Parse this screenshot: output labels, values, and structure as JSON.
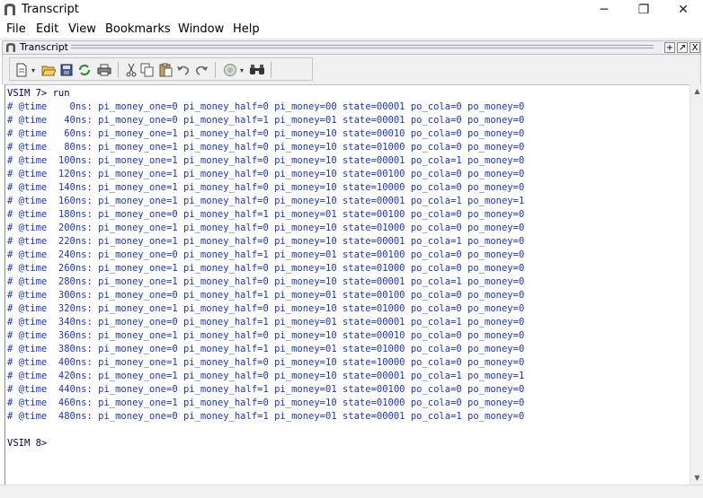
{
  "window": {
    "title": "Transcript",
    "minimize": "─",
    "maximize": "❐",
    "close": "✕"
  },
  "menu": [
    "File",
    "Edit",
    "View",
    "Bookmarks",
    "Window",
    "Help"
  ],
  "panel": {
    "title": "Transcript",
    "btn_dock": "+",
    "btn_undock": "↗",
    "btn_close": "X"
  },
  "toolbar": {
    "icons": [
      "new-document-icon",
      "open-folder-icon",
      "save-icon",
      "refresh-icon",
      "print-icon",
      "cut-icon",
      "copy-icon",
      "paste-icon",
      "undo-icon",
      "redo-icon",
      "run-icon",
      "find-icon"
    ]
  },
  "transcript": {
    "lines": [
      {
        "kind": "prompt",
        "text": "VSIM 7> run"
      },
      {
        "kind": "out",
        "text": "# @time    0ns: pi_money_one=0 pi_money_half=0 pi_money=00 state=00001 po_cola=0 po_money=0"
      },
      {
        "kind": "out",
        "text": "# @time   40ns: pi_money_one=0 pi_money_half=1 pi_money=01 state=00001 po_cola=0 po_money=0"
      },
      {
        "kind": "out",
        "text": "# @time   60ns: pi_money_one=1 pi_money_half=0 pi_money=10 state=00010 po_cola=0 po_money=0"
      },
      {
        "kind": "out",
        "text": "# @time   80ns: pi_money_one=1 pi_money_half=0 pi_money=10 state=01000 po_cola=0 po_money=0"
      },
      {
        "kind": "out",
        "text": "# @time  100ns: pi_money_one=1 pi_money_half=0 pi_money=10 state=00001 po_cola=1 po_money=0"
      },
      {
        "kind": "out",
        "text": "# @time  120ns: pi_money_one=1 pi_money_half=0 pi_money=10 state=00100 po_cola=0 po_money=0"
      },
      {
        "kind": "out",
        "text": "# @time  140ns: pi_money_one=1 pi_money_half=0 pi_money=10 state=10000 po_cola=0 po_money=0"
      },
      {
        "kind": "out",
        "text": "# @time  160ns: pi_money_one=1 pi_money_half=0 pi_money=10 state=00001 po_cola=1 po_money=1"
      },
      {
        "kind": "out",
        "text": "# @time  180ns: pi_money_one=0 pi_money_half=1 pi_money=01 state=00100 po_cola=0 po_money=0"
      },
      {
        "kind": "out",
        "text": "# @time  200ns: pi_money_one=1 pi_money_half=0 pi_money=10 state=01000 po_cola=0 po_money=0"
      },
      {
        "kind": "out",
        "text": "# @time  220ns: pi_money_one=1 pi_money_half=0 pi_money=10 state=00001 po_cola=1 po_money=0"
      },
      {
        "kind": "out",
        "text": "# @time  240ns: pi_money_one=0 pi_money_half=1 pi_money=01 state=00100 po_cola=0 po_money=0"
      },
      {
        "kind": "out",
        "text": "# @time  260ns: pi_money_one=1 pi_money_half=0 pi_money=10 state=01000 po_cola=0 po_money=0"
      },
      {
        "kind": "out",
        "text": "# @time  280ns: pi_money_one=1 pi_money_half=0 pi_money=10 state=00001 po_cola=1 po_money=0"
      },
      {
        "kind": "out",
        "text": "# @time  300ns: pi_money_one=0 pi_money_half=1 pi_money=01 state=00100 po_cola=0 po_money=0"
      },
      {
        "kind": "out",
        "text": "# @time  320ns: pi_money_one=1 pi_money_half=0 pi_money=10 state=01000 po_cola=0 po_money=0"
      },
      {
        "kind": "out",
        "text": "# @time  340ns: pi_money_one=0 pi_money_half=1 pi_money=01 state=00001 po_cola=1 po_money=0"
      },
      {
        "kind": "out",
        "text": "# @time  360ns: pi_money_one=1 pi_money_half=0 pi_money=10 state=00010 po_cola=0 po_money=0"
      },
      {
        "kind": "out",
        "text": "# @time  380ns: pi_money_one=0 pi_money_half=1 pi_money=01 state=01000 po_cola=0 po_money=0"
      },
      {
        "kind": "out",
        "text": "# @time  400ns: pi_money_one=1 pi_money_half=0 pi_money=10 state=10000 po_cola=0 po_money=0"
      },
      {
        "kind": "out",
        "text": "# @time  420ns: pi_money_one=1 pi_money_half=0 pi_money=10 state=00001 po_cola=1 po_money=1"
      },
      {
        "kind": "out",
        "text": "# @time  440ns: pi_money_one=0 pi_money_half=1 pi_money=01 state=00100 po_cola=0 po_money=0"
      },
      {
        "kind": "out",
        "text": "# @time  460ns: pi_money_one=1 pi_money_half=0 pi_money=10 state=01000 po_cola=0 po_money=0"
      },
      {
        "kind": "out",
        "text": "# @time  480ns: pi_money_one=0 pi_money_half=1 pi_money=01 state=00001 po_cola=1 po_money=0"
      },
      {
        "kind": "blank",
        "text": ""
      },
      {
        "kind": "prompt",
        "text": "VSIM 8>"
      }
    ]
  },
  "colors": {
    "prompt": "#000060",
    "output": "#1a35c9",
    "accent": "#0a246a"
  }
}
